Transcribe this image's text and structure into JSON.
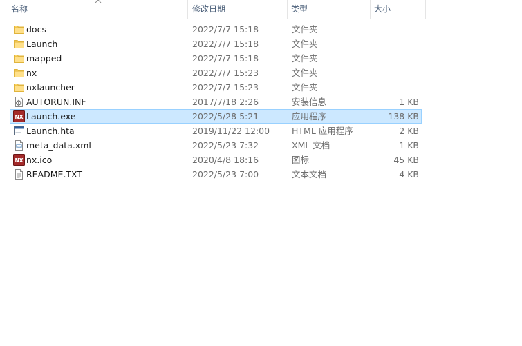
{
  "columns": {
    "name": "名称",
    "date": "修改日期",
    "type": "类型",
    "size": "大小"
  },
  "files": [
    {
      "name": "docs",
      "date": "2022/7/7 15:18",
      "type": "文件夹",
      "size": "",
      "icon": "folder-icon",
      "selected": false
    },
    {
      "name": "Launch",
      "date": "2022/7/7 15:18",
      "type": "文件夹",
      "size": "",
      "icon": "folder-icon",
      "selected": false
    },
    {
      "name": "mapped",
      "date": "2022/7/7 15:18",
      "type": "文件夹",
      "size": "",
      "icon": "folder-icon",
      "selected": false
    },
    {
      "name": "nx",
      "date": "2022/7/7 15:23",
      "type": "文件夹",
      "size": "",
      "icon": "folder-icon",
      "selected": false
    },
    {
      "name": "nxlauncher",
      "date": "2022/7/7 15:23",
      "type": "文件夹",
      "size": "",
      "icon": "folder-icon",
      "selected": false
    },
    {
      "name": "AUTORUN.INF",
      "date": "2017/7/18 2:26",
      "type": "安装信息",
      "size": "1 KB",
      "icon": "setup-info-icon",
      "selected": false
    },
    {
      "name": "Launch.exe",
      "date": "2022/5/28 5:21",
      "type": "应用程序",
      "size": "138 KB",
      "icon": "nx-app-icon",
      "selected": true
    },
    {
      "name": "Launch.hta",
      "date": "2019/11/22 12:00",
      "type": "HTML 应用程序",
      "size": "2 KB",
      "icon": "hta-window-icon",
      "selected": false
    },
    {
      "name": "meta_data.xml",
      "date": "2022/5/23 7:32",
      "type": "XML 文档",
      "size": "1 KB",
      "icon": "xml-document-icon",
      "selected": false
    },
    {
      "name": "nx.ico",
      "date": "2020/4/8 18:16",
      "type": "图标",
      "size": "45 KB",
      "icon": "nx-app-icon",
      "selected": false
    },
    {
      "name": "README.TXT",
      "date": "2022/5/23 7:00",
      "type": "文本文档",
      "size": "4 KB",
      "icon": "text-document-icon",
      "selected": false
    }
  ],
  "colors": {
    "selection_bg": "#cce8ff",
    "selection_border": "#99d1ff",
    "header_text": "#4c607a",
    "folder": "#ffd766"
  }
}
